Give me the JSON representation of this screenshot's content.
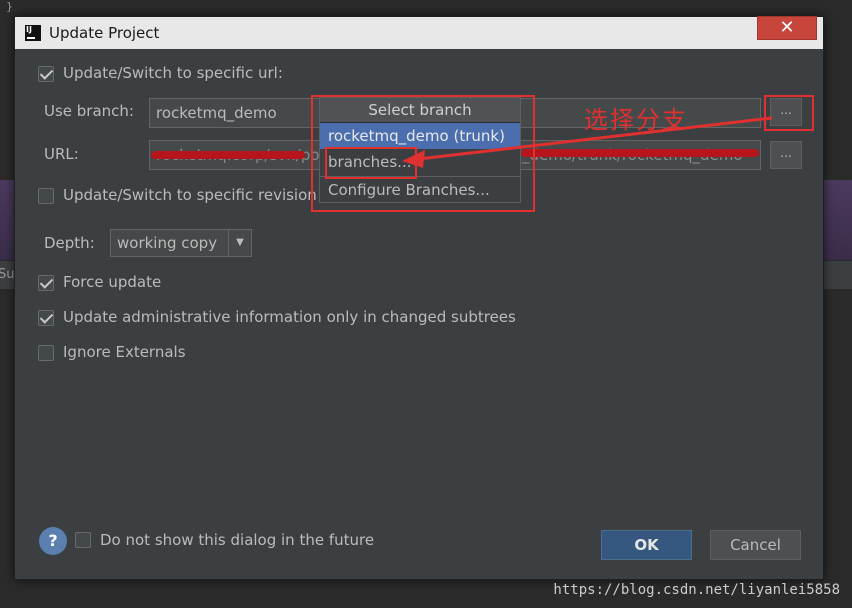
{
  "background": {
    "corner_text": "}",
    "strip_text": "Su"
  },
  "dialog": {
    "title": "Update Project",
    "close_icon": "✕",
    "switch_url_label": "Update/Switch to specific url:",
    "use_branch_label": "Use branch:",
    "use_branch_value": "rocketmq_demo",
    "url_label": "URL:",
    "url_value_left": "rocketmq.corp/svn/posel",
    "url_value_right": "_demo/trunk/rocketmq_demo",
    "dots_label": "...",
    "switch_revision_label": "Update/Switch to specific revision",
    "depth_label": "Depth:",
    "depth_value": "working copy",
    "force_update_label": "Force update",
    "update_admin_label": "Update administrative information only in changed subtrees",
    "ignore_externals_label": "Ignore Externals",
    "dont_show_label": "Do not show this dialog in the future",
    "help_label": "?",
    "ok_label": "OK",
    "cancel_label": "Cancel"
  },
  "branch_popup": {
    "header": "Select branch",
    "items": [
      "rocketmq_demo (trunk)",
      "branches...",
      "Configure Branches..."
    ]
  },
  "annotation": {
    "text": "选择分支",
    "color": "#e03030"
  },
  "watermark": "https://blog.csdn.net/liyanlei5858",
  "colors": {
    "accent": "#4b6eaf",
    "ok_button": "#365880",
    "dialog_bg": "#3c3f41"
  }
}
